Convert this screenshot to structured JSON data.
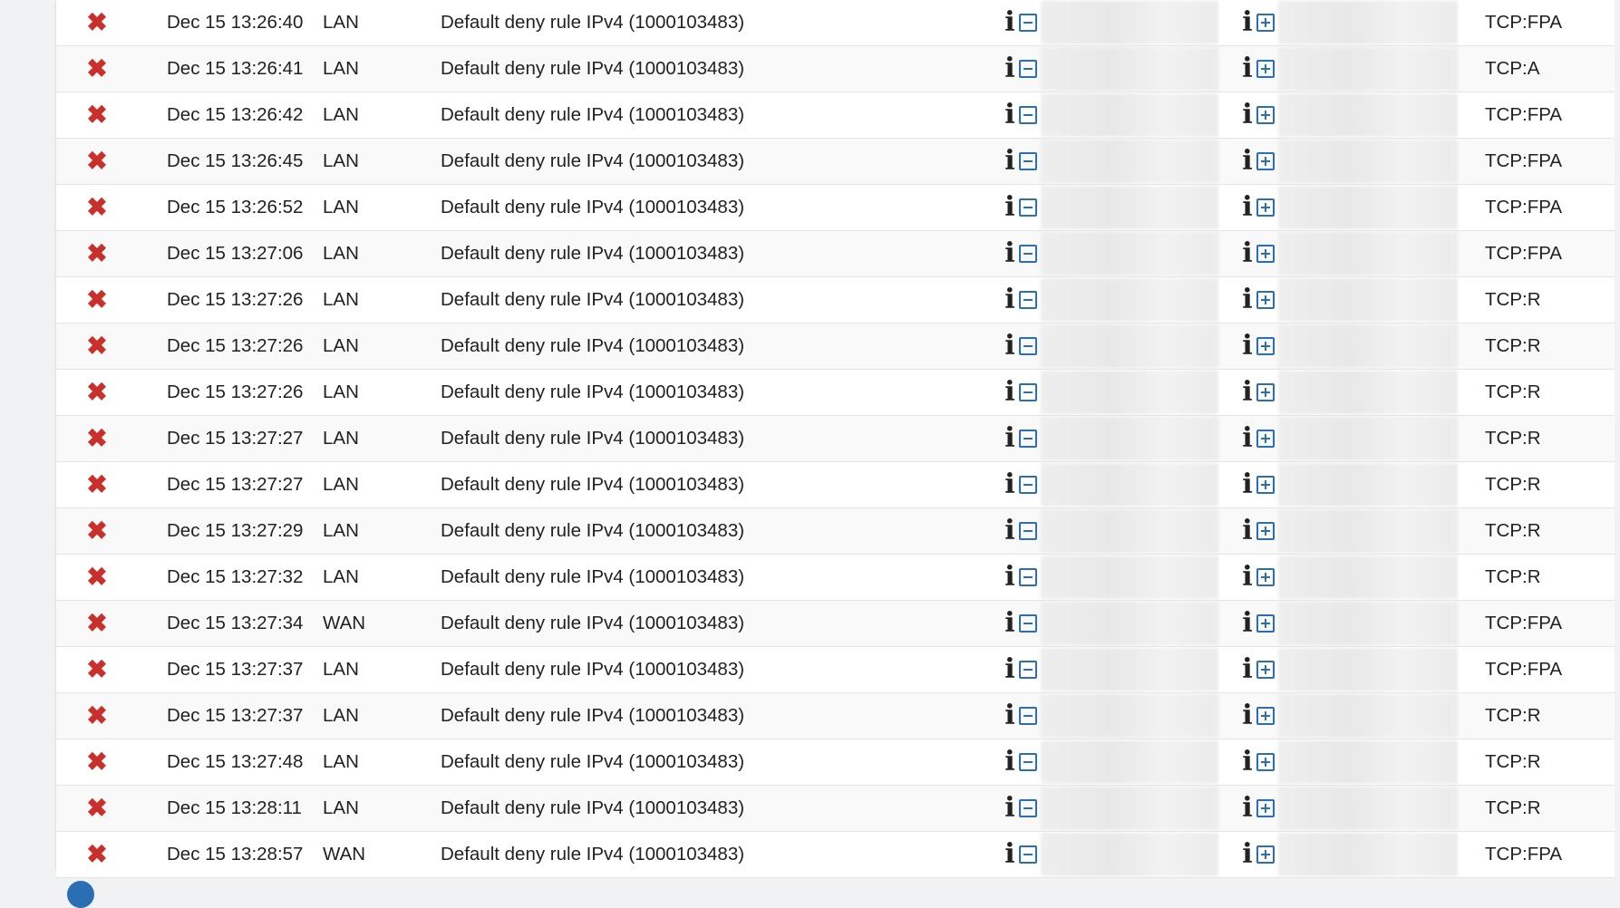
{
  "colors": {
    "block": "#c9302c",
    "accent": "#2a6fb3"
  },
  "icons": {
    "action": "block-x-icon",
    "info": "info-icon",
    "src_toggle": "minus-box-icon",
    "dst_toggle": "plus-box-icon"
  },
  "rows": [
    {
      "time": "Dec 15 13:26:40",
      "iface": "LAN",
      "rule": "Default deny rule IPv4 (1000103483)",
      "proto": "TCP:FPA"
    },
    {
      "time": "Dec 15 13:26:41",
      "iface": "LAN",
      "rule": "Default deny rule IPv4 (1000103483)",
      "proto": "TCP:A"
    },
    {
      "time": "Dec 15 13:26:42",
      "iface": "LAN",
      "rule": "Default deny rule IPv4 (1000103483)",
      "proto": "TCP:FPA"
    },
    {
      "time": "Dec 15 13:26:45",
      "iface": "LAN",
      "rule": "Default deny rule IPv4 (1000103483)",
      "proto": "TCP:FPA"
    },
    {
      "time": "Dec 15 13:26:52",
      "iface": "LAN",
      "rule": "Default deny rule IPv4 (1000103483)",
      "proto": "TCP:FPA"
    },
    {
      "time": "Dec 15 13:27:06",
      "iface": "LAN",
      "rule": "Default deny rule IPv4 (1000103483)",
      "proto": "TCP:FPA"
    },
    {
      "time": "Dec 15 13:27:26",
      "iface": "LAN",
      "rule": "Default deny rule IPv4 (1000103483)",
      "proto": "TCP:R"
    },
    {
      "time": "Dec 15 13:27:26",
      "iface": "LAN",
      "rule": "Default deny rule IPv4 (1000103483)",
      "proto": "TCP:R"
    },
    {
      "time": "Dec 15 13:27:26",
      "iface": "LAN",
      "rule": "Default deny rule IPv4 (1000103483)",
      "proto": "TCP:R"
    },
    {
      "time": "Dec 15 13:27:27",
      "iface": "LAN",
      "rule": "Default deny rule IPv4 (1000103483)",
      "proto": "TCP:R"
    },
    {
      "time": "Dec 15 13:27:27",
      "iface": "LAN",
      "rule": "Default deny rule IPv4 (1000103483)",
      "proto": "TCP:R"
    },
    {
      "time": "Dec 15 13:27:29",
      "iface": "LAN",
      "rule": "Default deny rule IPv4 (1000103483)",
      "proto": "TCP:R"
    },
    {
      "time": "Dec 15 13:27:32",
      "iface": "LAN",
      "rule": "Default deny rule IPv4 (1000103483)",
      "proto": "TCP:R"
    },
    {
      "time": "Dec 15 13:27:34",
      "iface": "WAN",
      "rule": "Default deny rule IPv4 (1000103483)",
      "proto": "TCP:FPA"
    },
    {
      "time": "Dec 15 13:27:37",
      "iface": "LAN",
      "rule": "Default deny rule IPv4 (1000103483)",
      "proto": "TCP:FPA"
    },
    {
      "time": "Dec 15 13:27:37",
      "iface": "LAN",
      "rule": "Default deny rule IPv4 (1000103483)",
      "proto": "TCP:R"
    },
    {
      "time": "Dec 15 13:27:48",
      "iface": "LAN",
      "rule": "Default deny rule IPv4 (1000103483)",
      "proto": "TCP:R"
    },
    {
      "time": "Dec 15 13:28:11",
      "iface": "LAN",
      "rule": "Default deny rule IPv4 (1000103483)",
      "proto": "TCP:R"
    },
    {
      "time": "Dec 15 13:28:57",
      "iface": "WAN",
      "rule": "Default deny rule IPv4 (1000103483)",
      "proto": "TCP:FPA"
    }
  ]
}
